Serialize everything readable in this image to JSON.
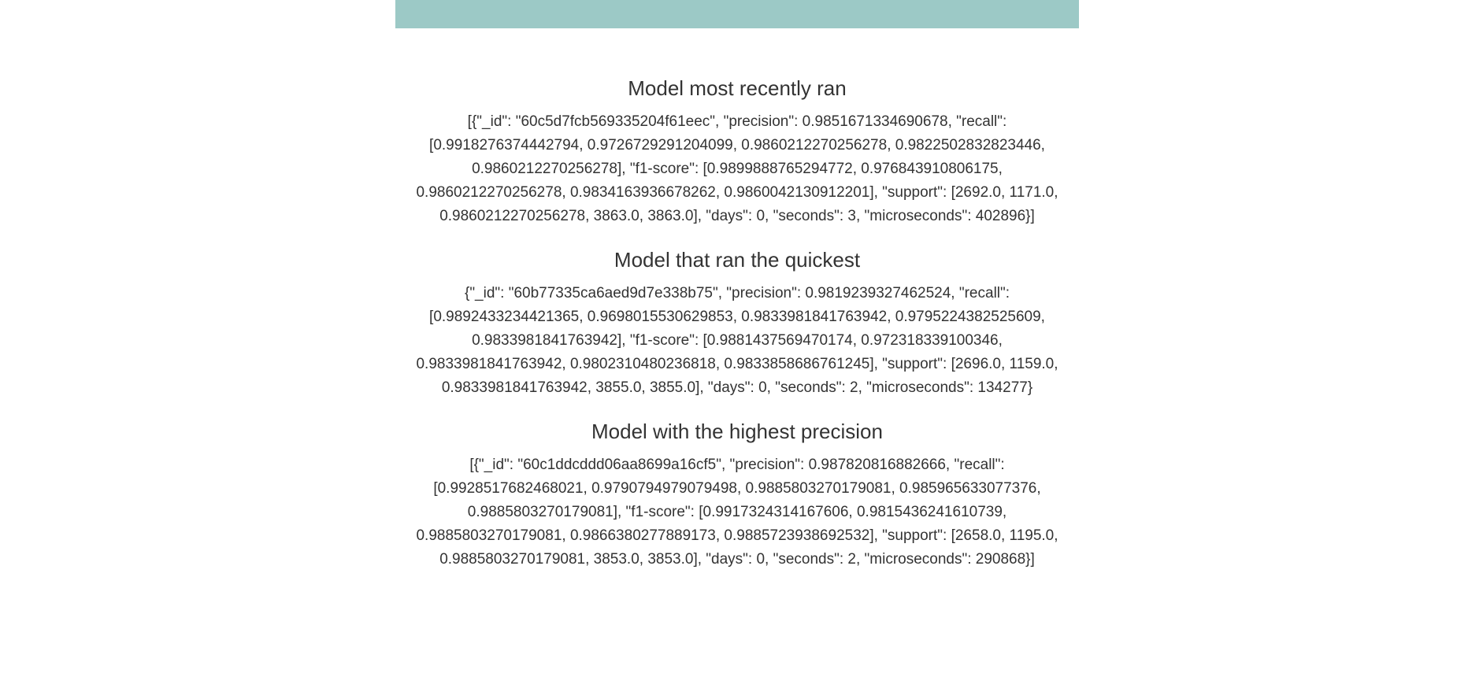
{
  "sections": [
    {
      "title": "Model most recently ran",
      "body": "[{\"_id\": \"60c5d7fcb569335204f61eec\", \"precision\": 0.9851671334690678, \"recall\": [0.9918276374442794, 0.9726729291204099, 0.9860212270256278, 0.9822502832823446, 0.9860212270256278], \"f1-score\": [0.9899888765294772, 0.976843910806175, 0.9860212270256278, 0.9834163936678262, 0.9860042130912201], \"support\": [2692.0, 1171.0, 0.9860212270256278, 3863.0, 3863.0], \"days\": 0, \"seconds\": 3, \"microseconds\": 402896}]"
    },
    {
      "title": "Model that ran the quickest",
      "body": "{\"_id\": \"60b77335ca6aed9d7e338b75\", \"precision\": 0.9819239327462524, \"recall\": [0.9892433234421365, 0.9698015530629853, 0.9833981841763942, 0.9795224382525609, 0.9833981841763942], \"f1-score\": [0.9881437569470174, 0.972318339100346, 0.9833981841763942, 0.9802310480236818, 0.9833858686761245], \"support\": [2696.0, 1159.0, 0.9833981841763942, 3855.0, 3855.0], \"days\": 0, \"seconds\": 2, \"microseconds\": 134277}"
    },
    {
      "title": "Model with the highest precision",
      "body": "[{\"_id\": \"60c1ddcddd06aa8699a16cf5\", \"precision\": 0.987820816882666, \"recall\": [0.9928517682468021, 0.9790794979079498, 0.9885803270179081, 0.985965633077376, 0.9885803270179081], \"f1-score\": [0.9917324314167606, 0.9815436241610739, 0.9885803270179081, 0.9866380277889173, 0.9885723938692532], \"support\": [2658.0, 1195.0, 0.9885803270179081, 3853.0, 3853.0], \"days\": 0, \"seconds\": 2, \"microseconds\": 290868}]"
    }
  ],
  "colors": {
    "header_bar": "#9cc9c6",
    "text": "#333333",
    "background": "#ffffff"
  }
}
